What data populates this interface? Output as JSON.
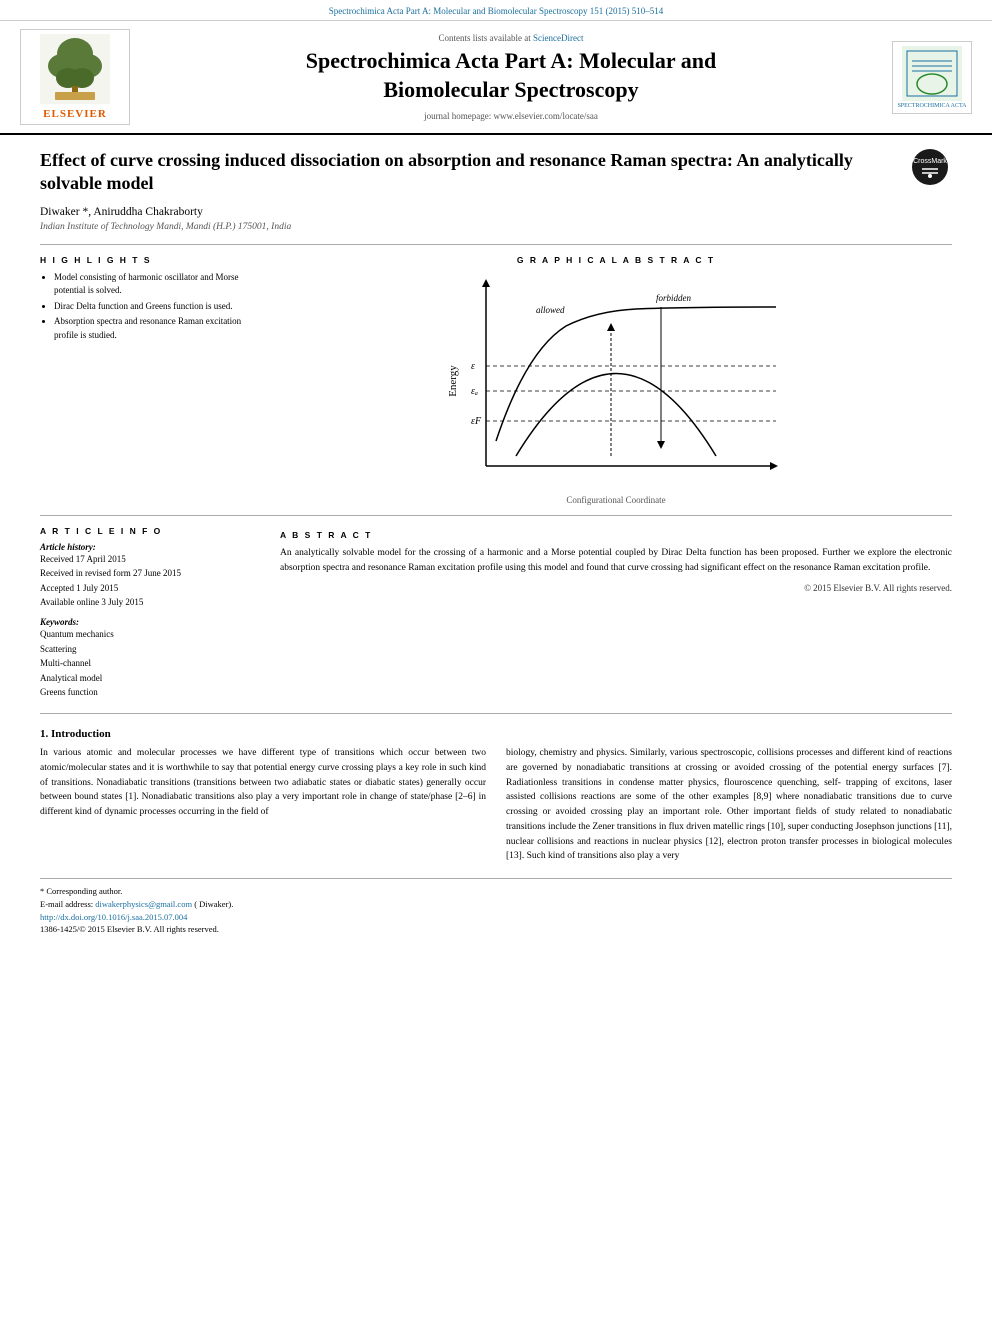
{
  "top_bar": {
    "journal_ref": "Spectrochimica Acta Part A: Molecular and Biomolecular Spectroscopy 151 (2015) 510–514"
  },
  "header": {
    "contents_line": "Contents lists available at",
    "science_direct": "ScienceDirect",
    "journal_title": "Spectrochimica Acta Part A: Molecular and\nBiomolecular Spectroscopy",
    "journal_homepage": "journal homepage: www.elsevier.com/locate/saa",
    "elsevier_text": "ELSEVIER",
    "spectro_text": "SPECTROCHIMICA ACTA"
  },
  "article": {
    "title": "Effect of curve crossing induced dissociation on absorption and resonance Raman spectra: An analytically solvable model",
    "authors": "Diwaker *, Aniruddha Chakraborty",
    "affiliation": "Indian Institute of Technology Mandi, Mandi (H.P.) 175001, India"
  },
  "highlights": {
    "heading": "H I G H L I G H T S",
    "items": [
      "Model consisting of harmonic oscillator and Morse potential is solved.",
      "Dirac Delta function and Greens function is used.",
      "Absorption spectra and resonance Raman excitation profile is studied."
    ]
  },
  "graphical_abstract": {
    "heading": "G R A P H I C A L   A B S T R A C T",
    "caption": "Configurational Coordinate",
    "y_label": "Energy",
    "labels": {
      "allowed": "allowed",
      "forbidden": "forbidden",
      "epsilon_a": "εₐ",
      "epsilon": "ε",
      "epsilon_f": "εF"
    }
  },
  "article_info": {
    "heading": "A R T I C L E   I N F O",
    "history_label": "Article history:",
    "received": "Received 17 April 2015",
    "revised": "Received in revised form 27 June 2015",
    "accepted": "Accepted 1 July 2015",
    "available": "Available online 3 July 2015",
    "keywords_label": "Keywords:",
    "keywords": [
      "Quantum mechanics",
      "Scattering",
      "Multi-channel",
      "Analytical model",
      "Greens function"
    ]
  },
  "abstract": {
    "heading": "A B S T R A C T",
    "text": "An analytically solvable model for the crossing of a harmonic and a Morse potential coupled by Dirac Delta function has been proposed. Further we explore the electronic absorption spectra and resonance Raman excitation profile using this model and found that curve crossing had significant effect on the resonance Raman excitation profile.",
    "copyright": "© 2015 Elsevier B.V. All rights reserved."
  },
  "introduction": {
    "heading": "1. Introduction",
    "left_text": "In various atomic and molecular processes we have different type of transitions which occur between two atomic/molecular states and it is worthwhile to say that potential energy curve crossing plays a key role in such kind of transitions. Nonadiabatic transitions (transitions between two adiabatic states or diabatic states) generally occur between bound states [1]. Nonadiabatic transitions also play a very important role in change of state/phase [2–6] in different kind of dynamic processes occurring in the field of",
    "right_text": "biology, chemistry and physics. Similarly, various spectroscopic, collisions processes and different kind of reactions are governed by nonadiabatic transitions at crossing or avoided crossing of the potential energy surfaces [7]. Radiationless transitions in condense matter physics, flouroscence quenching, self- trapping of excitons, laser assisted collisions reactions are some of the other examples [8,9] where nonadiabatic transitions due to curve crossing or avoided crossing play an important role. Other important fields of study related to nonadiabatic transitions include the Zener transitions in flux driven matellic rings [10], super conducting Josephson junctions [11], nuclear collisions and reactions in nuclear physics [12], electron proton transfer processes in biological molecules [13]. Such kind of transitions also play a very"
  },
  "footnote": {
    "corresponding": "* Corresponding author.",
    "email_label": "E-mail address:",
    "email": "diwakerphysics@gmail.com",
    "email_suffix": "( Diwaker).",
    "doi": "http://dx.doi.org/10.1016/j.saa.2015.07.004",
    "issn": "1386-1425/© 2015 Elsevier B.V. All rights reserved."
  }
}
